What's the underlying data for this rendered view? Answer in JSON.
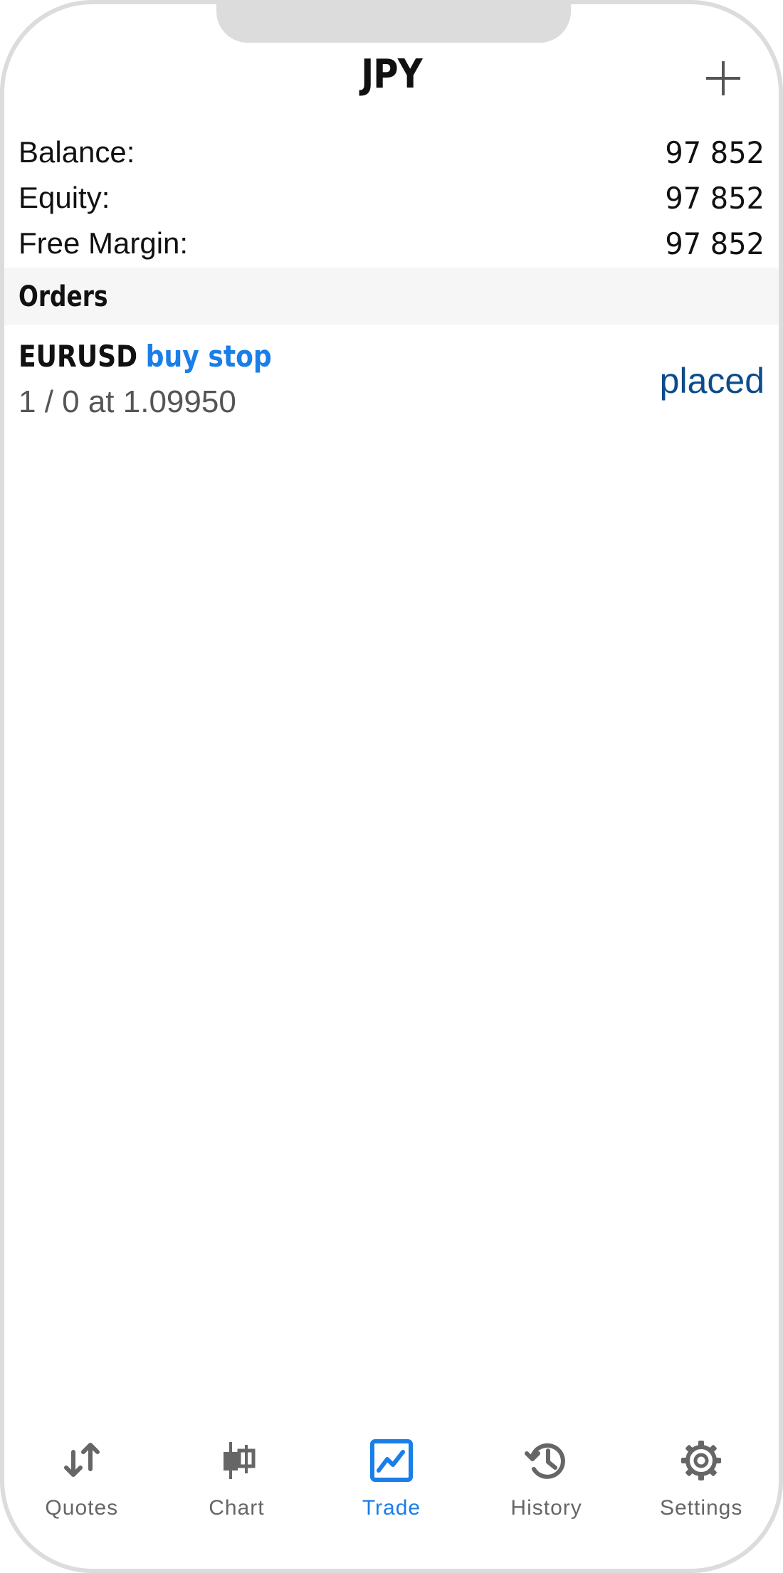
{
  "header": {
    "title": "JPY"
  },
  "summary": [
    {
      "label": "Balance:",
      "value": "97 852"
    },
    {
      "label": "Equity:",
      "value": "97 852"
    },
    {
      "label": "Free Margin:",
      "value": "97 852"
    }
  ],
  "orders": {
    "section_title": "Orders",
    "items": [
      {
        "symbol": "EURUSD",
        "type": "buy stop",
        "details": "1 / 0 at 1.09950",
        "status": "placed"
      }
    ]
  },
  "tabbar": {
    "quotes": "Quotes",
    "chart": "Chart",
    "trade": "Trade",
    "history": "History",
    "settings": "Settings",
    "active": "trade"
  },
  "colors": {
    "accent": "#1a7ee8",
    "status": "#0d4c8b",
    "section_bg": "#f6f6f6",
    "frame": "#dcdcdc"
  }
}
